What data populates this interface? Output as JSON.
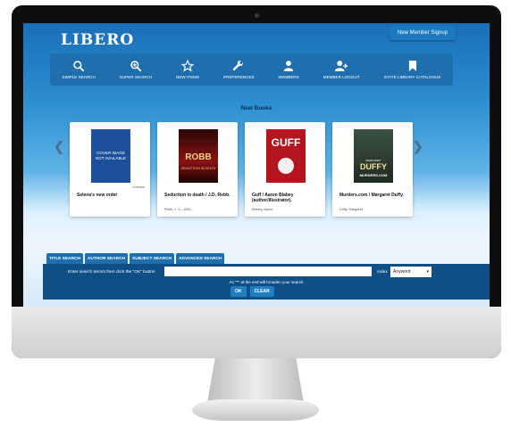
{
  "app": {
    "logo": "LIBERO",
    "signup": "New Member Signup"
  },
  "nav": [
    {
      "label": "SIMPLE SEARCH",
      "icon": "search-icon"
    },
    {
      "label": "SUPER SEARCH",
      "icon": "zoom-in-icon"
    },
    {
      "label": "NEW ITEMS",
      "icon": "star-icon"
    },
    {
      "label": "PREFERENCES",
      "icon": "wrench-icon"
    },
    {
      "label": "MEMBERS",
      "icon": "user-icon"
    },
    {
      "label": "MEMBER LOGOUT",
      "icon": "user-plus-icon"
    },
    {
      "label": "STATE LIBRARY CATALOGUE",
      "icon": "bookmark-icon"
    }
  ],
  "newbooks": {
    "title": "New Books",
    "items": [
      {
        "cover_text": "COVER IMAGE NOT AVAILABLE",
        "title": "Selena's new order",
        "meta": "",
        "tag": "JUNFRED",
        "cover_color": "#1d4f9a"
      },
      {
        "cover_text": "ROBB",
        "cover_sub": "SEDUCTION IN DEATH",
        "title": "Seduction in death / J.D. Robb.",
        "meta": "Robb, J. D., 1950-",
        "cover_color": "#7a1111"
      },
      {
        "cover_text": "GUFF",
        "title": "Guff / Aaron Blabey (author/illustrator).",
        "meta": "Blabey, Aaron",
        "cover_color": "#b3161f"
      },
      {
        "cover_text": "DUFFY",
        "cover_sub": "MURDERS.COM",
        "cover_top": "MARGARET",
        "title": "Murders.com / Margaret Duffy.",
        "meta": "Duffy, Margaret",
        "cover_color": "#2e3a2c"
      }
    ]
  },
  "search": {
    "tabs": [
      "TITLE SEARCH",
      "AUTHOR SEARCH",
      "SUBJECT SEARCH",
      "ADVANCED SEARCH"
    ],
    "instruction": "Enter search term/s then click the \"OK\" button",
    "index_label": "Index",
    "index_value": "Anyword",
    "note": "An \"*\" at the end will broaden your search",
    "ok": "OK",
    "clear": "CLEAR"
  }
}
